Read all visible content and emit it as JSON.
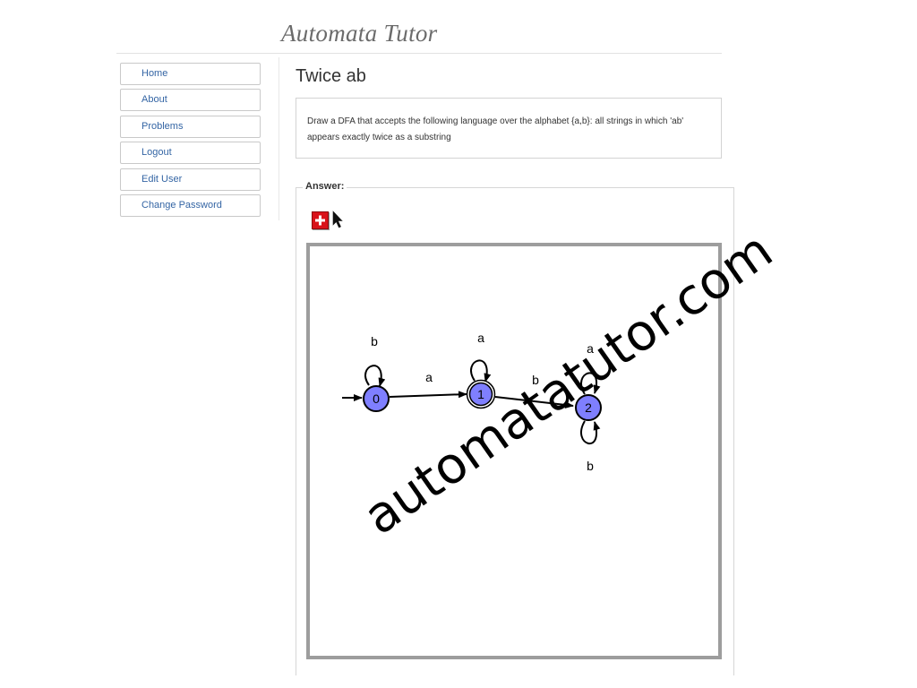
{
  "site": {
    "title": "Automata Tutor"
  },
  "sidebar": {
    "items": [
      {
        "label": "Home"
      },
      {
        "label": "About"
      },
      {
        "label": "Problems"
      },
      {
        "label": "Logout"
      },
      {
        "label": "Edit User"
      },
      {
        "label": "Change Password"
      }
    ]
  },
  "problem": {
    "title": "Twice ab",
    "description": "Draw a DFA that accepts the following language over the alphabet {a,b}: all strings in which 'ab' appears exactly twice as a substring"
  },
  "answer": {
    "legend": "Answer:",
    "tools": {
      "add_state_icon": "plus-icon",
      "pointer_icon": "cursor-arrow-icon"
    }
  },
  "automaton": {
    "state_fill": "#7f7fff",
    "states": [
      {
        "id": "0",
        "label": "0",
        "initial": true,
        "accepting": false
      },
      {
        "id": "1",
        "label": "1",
        "initial": false,
        "accepting": true
      },
      {
        "id": "2",
        "label": "2",
        "initial": false,
        "accepting": false
      }
    ],
    "transitions": [
      {
        "from": "0",
        "to": "0",
        "label": "b"
      },
      {
        "from": "0",
        "to": "1",
        "label": "a"
      },
      {
        "from": "1",
        "to": "1",
        "label": "a"
      },
      {
        "from": "1",
        "to": "2",
        "label": "b"
      },
      {
        "from": "2",
        "to": "2",
        "label": "a"
      },
      {
        "from": "2",
        "to": "2",
        "label": "b"
      }
    ]
  },
  "watermark": {
    "text": "automatatutor.com"
  }
}
